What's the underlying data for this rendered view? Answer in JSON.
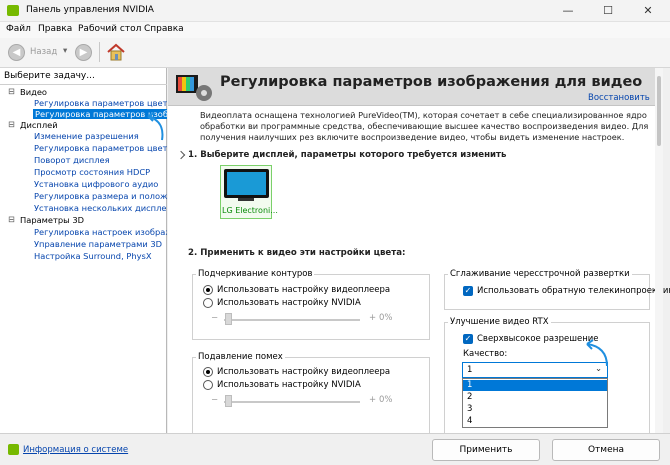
{
  "window": {
    "title": "Панель управления NVIDIA",
    "minimize": "—",
    "maximize": "☐",
    "close": "✕"
  },
  "menu": [
    "Файл",
    "Правка",
    "Рабочий стол",
    "Справка"
  ],
  "toolbar": {
    "back": "Назад"
  },
  "left_panel": {
    "header": "Выберите задачу...",
    "tree": [
      {
        "label": "Видео",
        "kind": "cat",
        "expander": "⊟"
      },
      {
        "label": "Регулировка параметров цвета для",
        "kind": "link"
      },
      {
        "label": "Регулировка параметров изображ",
        "kind": "sel"
      },
      {
        "label": "Дисплей",
        "kind": "cat",
        "expander": "⊟"
      },
      {
        "label": "Изменение разрешения",
        "kind": "link"
      },
      {
        "label": "Регулировка параметров цвета ра",
        "kind": "link"
      },
      {
        "label": "Поворот дисплея",
        "kind": "link"
      },
      {
        "label": "Просмотр состояния HDCP",
        "kind": "link"
      },
      {
        "label": "Установка цифрового аудио",
        "kind": "link"
      },
      {
        "label": "Регулировка размера и положения",
        "kind": "link"
      },
      {
        "label": "Установка нескольких дисплеев",
        "kind": "link"
      },
      {
        "label": "Параметры 3D",
        "kind": "cat",
        "expander": "⊟"
      },
      {
        "label": "Регулировка настроек изображен",
        "kind": "link"
      },
      {
        "label": "Управление параметрами 3D",
        "kind": "link"
      },
      {
        "label": "Настройка Surround, PhysX",
        "kind": "link"
      }
    ]
  },
  "main": {
    "title": "Регулировка параметров изображения для видео",
    "restore": "Восстановить",
    "description": "Видеоплата оснащена технологией PureVideo(TM), которая сочетает в себе специализированное ядро обработки ви программные средства, обеспечивающие высшее качество воспроизведения видео. Для получения наилучших рез включите воспроизведение видео, чтобы видеть изменение настроек.",
    "step1": "1. Выберите дисплей, параметры которого требуется изменить",
    "display_name": "LG Electroni...",
    "step2": "2. Применить к видео эти настройки цвета:",
    "edge": {
      "title": "Подчеркивание контуров",
      "opt1": "Использовать настройку видеоплеера",
      "opt2": "Использовать настройку NVIDIA",
      "minus": "−",
      "plus": "+",
      "value": "0%"
    },
    "noise": {
      "title": "Подавление помех",
      "opt1": "Использовать настройку видеоплеера",
      "opt2": "Использовать настройку NVIDIA",
      "minus": "−",
      "plus": "+",
      "value": "0%"
    },
    "deinterlace": {
      "title": "Сглаживание чересстрочной развертки",
      "check": "Использовать обратную телекинопроекцию"
    },
    "rtx": {
      "title": "Улучшение видео RTX",
      "check": "Сверхвысокое разрешение",
      "quality_label": "Качество:",
      "selected": "1",
      "options": [
        "1",
        "2",
        "3",
        "4"
      ]
    }
  },
  "footer": {
    "sysinfo": "Информация о системе",
    "apply": "Применить",
    "cancel": "Отмена"
  },
  "colors": {
    "accent": "#0078d7",
    "nvidia_green": "#76b900",
    "annotation": "#1f8fe0"
  }
}
